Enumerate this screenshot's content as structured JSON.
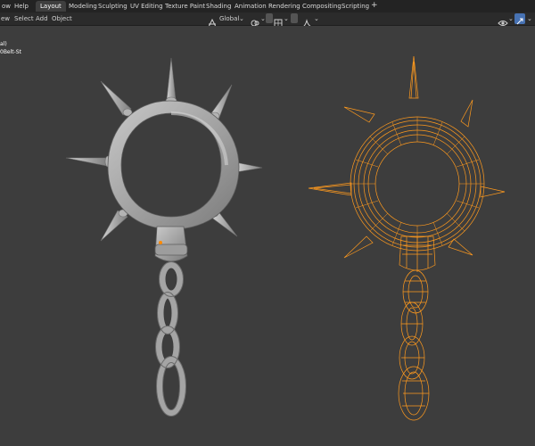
{
  "topbar": {
    "menus": [
      "ow",
      "Help"
    ],
    "workspace_tabs": [
      "Layout",
      "Modeling",
      "Sculpting",
      "UV Editing",
      "Texture Paint",
      "Shading",
      "Animation",
      "Rendering",
      "Compositing",
      "Scripting"
    ],
    "active_tab": "Layout",
    "add_tab": "+"
  },
  "toolbar": {
    "menus": [
      "ew",
      "Select",
      "Add",
      "Object"
    ],
    "orientation": "Global"
  },
  "viewport": {
    "overlay_line1": "al)",
    "overlay_line2": "0Belt-St"
  },
  "colors": {
    "topbar_bg": "#232323",
    "viewport_bg": "#3d3d3d",
    "solid_mesh": "#a9a9a9",
    "wireframe": "#ff9a1e",
    "active_gizmo": "#4772b3"
  },
  "objects": [
    {
      "name": "spiked-collar-chain-solid",
      "shading": "solid"
    },
    {
      "name": "spiked-collar-chain-wireframe",
      "shading": "wireframe-selected"
    }
  ]
}
